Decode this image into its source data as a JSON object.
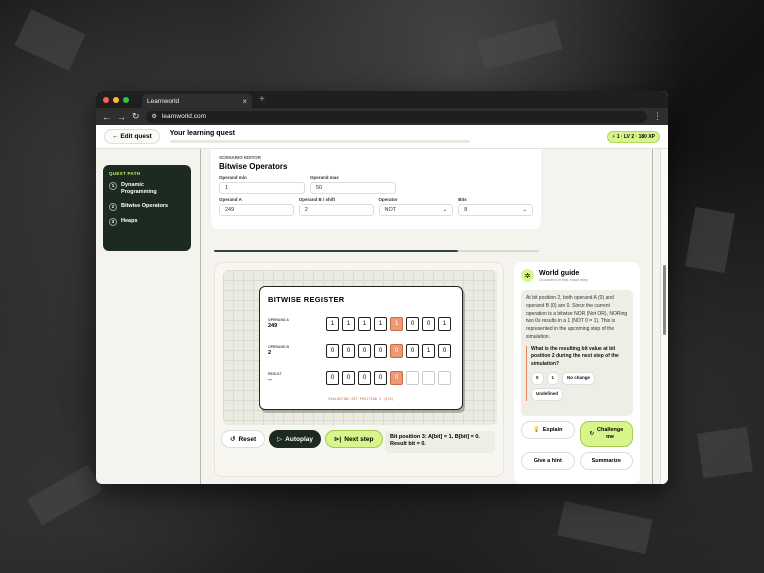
{
  "browser": {
    "tab_title": "Learnworld",
    "url": "learnworld.com"
  },
  "header": {
    "edit_label": "Edit quest",
    "title": "Your learning quest",
    "xp_badge": "1 · LV 2 · 180 XP"
  },
  "sidebar": {
    "heading": "QUEST PATH",
    "items": [
      {
        "num": "1",
        "label": "Dynamic Programming"
      },
      {
        "num": "2",
        "label": "Bitwise Operators"
      },
      {
        "num": "3",
        "label": "Heaps"
      }
    ]
  },
  "scenario": {
    "label": "SCENARIO EDITOR",
    "title": "Bitwise Operators",
    "operand_min_label": "Operand min",
    "operand_min": "1",
    "operand_max_label": "Operand max",
    "operand_max": "50",
    "operand_a_label": "Operand A",
    "operand_a": "249",
    "operand_b_label": "Operand B / shift",
    "operand_b": "2",
    "operator_label": "Operator",
    "operator": "NOT",
    "bits_label": "Bits",
    "bits": "8",
    "progress": 0.75
  },
  "register": {
    "title": "BITWISE REGISTER",
    "rows": [
      {
        "label": "OPERAND A",
        "value": "249",
        "bits": [
          "1",
          "1",
          "1",
          "1",
          "1",
          "0",
          "0",
          "1"
        ]
      },
      {
        "label": "OPERAND B",
        "value": "2",
        "bits": [
          "0",
          "0",
          "0",
          "0",
          "0",
          "0",
          "1",
          "0"
        ]
      },
      {
        "label": "RESULT",
        "value": "--",
        "bits": [
          "0",
          "0",
          "0",
          "0",
          "0",
          "",
          "",
          ""
        ]
      }
    ],
    "highlight_index": 4,
    "eval_note": "EVALUATING BIT POSITION 3 (3/8)"
  },
  "controls": {
    "reset": "Reset",
    "autoplay": "Autoplay",
    "next": "Next step",
    "status": "Bit position 3: A[bit] = 1, B[bit] = 0. Result bit = 0."
  },
  "guide": {
    "title": "World guide",
    "subtitle": "Grounded in this exact step",
    "message": "At bit position 2, both operand A (0) and operand B (0) are 0. Since the current operation is a bitwise NOR (Not OR), NORing two 0s results in a 1 (NOT 0 = 1). This is represented in the upcoming step of the simulation.",
    "question": "What is the resulting bit value at bit position 2 during the next step of the simulation?",
    "options": [
      "0",
      "1",
      "No change",
      "Undefined"
    ],
    "explain": "Explain",
    "challenge": "Challenge me",
    "hint": "Give a hint",
    "summarize": "Summarize"
  }
}
